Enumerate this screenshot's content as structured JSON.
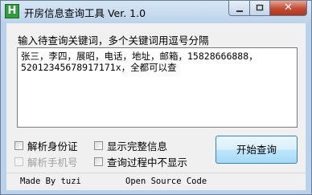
{
  "window": {
    "icon_letter": "H",
    "title": "开房信息查询工具 Ver. 1.0",
    "minimize_glyph": "▁",
    "maximize_glyph": "▭",
    "close_glyph": "✕"
  },
  "query": {
    "prompt": "输入待查询关键词，多个关键词用逗号分隔",
    "value": "张三，李四，展昭，电话，地址，邮箱，15828666888，\n52012345678917171x，全都可以查"
  },
  "options": {
    "parse_id": {
      "label": "解析身份证",
      "checked": false,
      "enabled": true
    },
    "show_full": {
      "label": "显示完整信息",
      "checked": false,
      "enabled": true
    },
    "parse_phone": {
      "label": "解析手机号",
      "checked": false,
      "enabled": false
    },
    "hide_process": {
      "label": "查询过程中不显示",
      "checked": false,
      "enabled": true
    }
  },
  "start_button": {
    "label": "开始查询"
  },
  "status": {
    "left": "Made By tuzi",
    "right": "Open Source Code"
  },
  "colors": {
    "title_bar": "#bcd3ea",
    "close_button": "#c44a32",
    "client_bg": "#f0f0f0",
    "button_border": "#3c7fb1"
  }
}
